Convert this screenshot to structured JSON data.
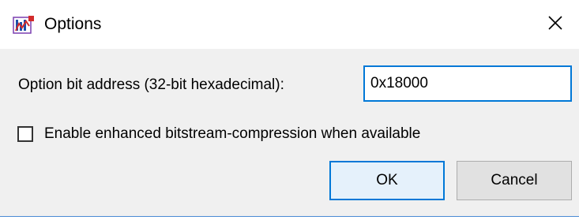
{
  "window": {
    "title": "Options",
    "app_icon": "quartus-app-icon",
    "close_icon": "close-icon"
  },
  "form": {
    "address_label": "Option bit address (32-bit hexadecimal):",
    "address_value": "0x18000",
    "compression_checkbox": {
      "label": "Enable enhanced bitstream-compression when available",
      "checked": false
    }
  },
  "buttons": {
    "ok_label": "OK",
    "cancel_label": "Cancel"
  },
  "colors": {
    "accent": "#0078d7",
    "panel_background": "#f0f0f0"
  }
}
